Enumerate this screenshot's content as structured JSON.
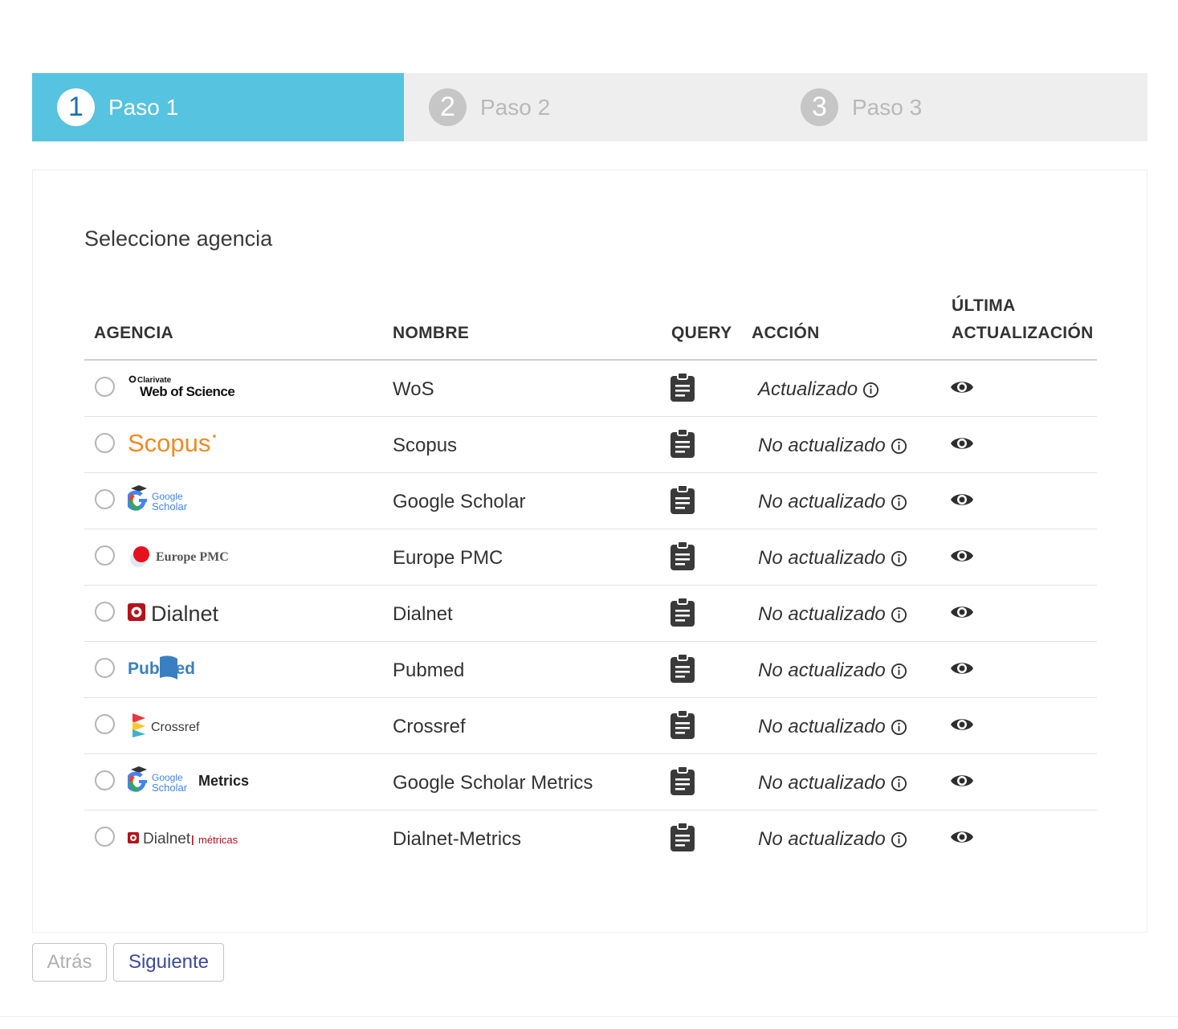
{
  "stepper": {
    "steps": [
      {
        "number": "1",
        "label": "Paso 1",
        "active": true
      },
      {
        "number": "2",
        "label": "Paso 2",
        "active": false
      },
      {
        "number": "3",
        "label": "Paso 3",
        "active": false
      }
    ]
  },
  "card": {
    "title": "Seleccione agencia"
  },
  "table": {
    "headers": {
      "agencia": "AGENCIA",
      "nombre": "NOMBRE",
      "query": "QUERY",
      "accion": "ACCIÓN",
      "ultima_1": "ÚLTIMA",
      "ultima_2": "ACTUALIZACIÓN"
    },
    "rows": [
      {
        "logo": "Web of Science",
        "logo_prefix": "Clarivate",
        "name": "WoS",
        "accion": "Actualizado"
      },
      {
        "logo": "Scopus",
        "name": "Scopus",
        "accion": "No actualizado"
      },
      {
        "logo": "Google Scholar",
        "logo_l1": "Google",
        "logo_l2": "Scholar",
        "name": "Google Scholar",
        "accion": "No actualizado"
      },
      {
        "logo": "Europe PMC",
        "name": "Europe PMC",
        "accion": "No actualizado"
      },
      {
        "logo": "Dialnet",
        "name": "Dialnet",
        "accion": "No actualizado"
      },
      {
        "logo": "PubMed",
        "logo_a": "Publ",
        "logo_b": "Med",
        "name": "Pubmed",
        "accion": "No actualizado"
      },
      {
        "logo": "Crossref",
        "name": "Crossref",
        "accion": "No actualizado"
      },
      {
        "logo": "Metrics",
        "logo_l1": "Google",
        "logo_l2": "Scholar",
        "name": "Google Scholar Metrics",
        "accion": "No actualizado"
      },
      {
        "logo": "Dialnet",
        "logo_suffix": "métricas",
        "name": "Dialnet-Metrics",
        "accion": "No actualizado"
      }
    ]
  },
  "buttons": {
    "back": "Atrás",
    "next": "Siguiente"
  },
  "colors": {
    "active_step": "#56c3e0",
    "inactive_step_bg": "#eeeeee",
    "next_button_text": "#3a4aa0"
  }
}
